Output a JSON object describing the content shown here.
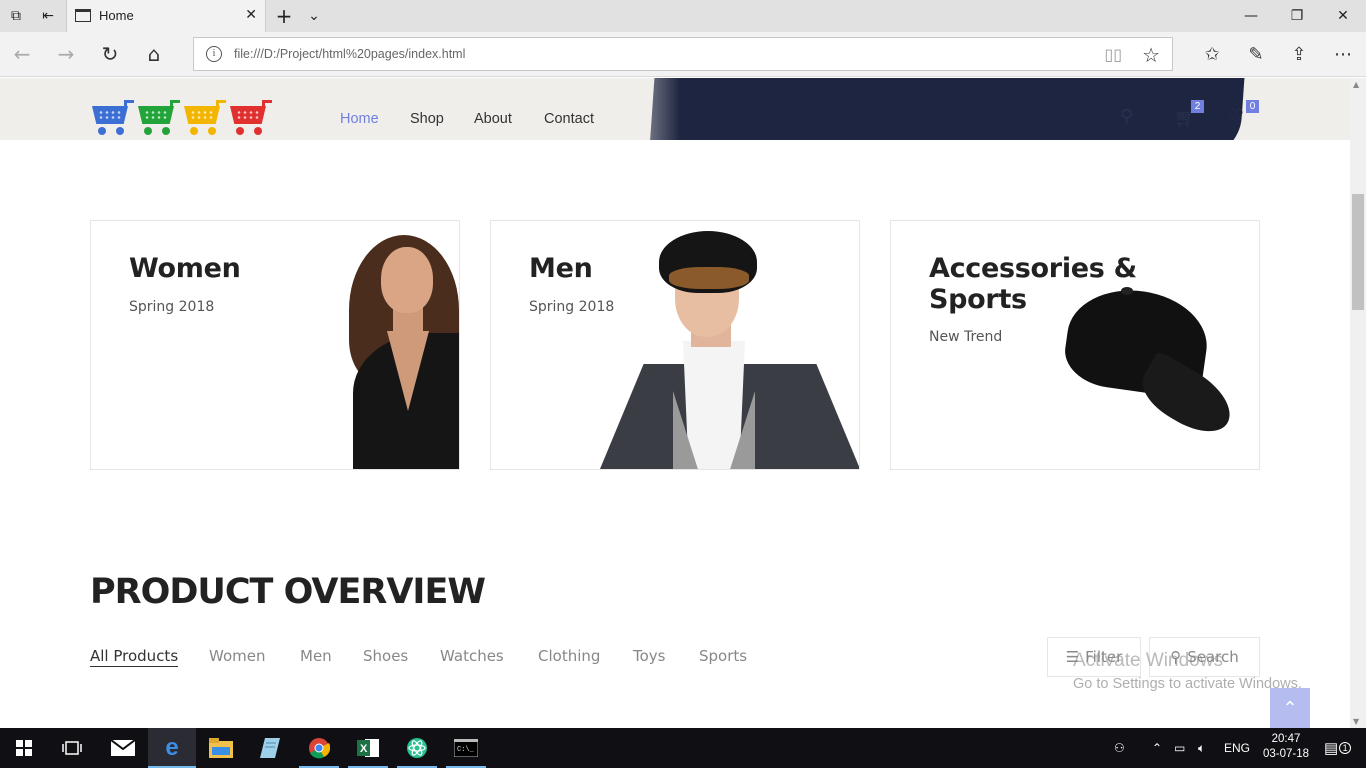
{
  "browser": {
    "tab_title": "Home",
    "url": "file:///D:/Project/html%20pages/index.html",
    "icons": [
      "tab-preview-icon",
      "set-aside-tabs-icon",
      "new-tab-icon",
      "tab-list-icon",
      "back-icon",
      "forward-icon",
      "refresh-icon",
      "home-icon",
      "reading-view-icon",
      "favorite-star-icon",
      "favorites-hub-icon",
      "notes-pen-icon",
      "share-icon",
      "more-icon"
    ]
  },
  "site": {
    "nav": [
      {
        "label": "Home",
        "active": true
      },
      {
        "label": "Shop",
        "active": false
      },
      {
        "label": "About",
        "active": false
      },
      {
        "label": "Contact",
        "active": false
      }
    ],
    "cart_count": "2",
    "wishlist_count": "0",
    "logo_colors": [
      "#3b6fd4",
      "#22a43a",
      "#f2b600",
      "#e03030"
    ]
  },
  "banners": [
    {
      "title": "Women",
      "subtitle": "Spring 2018"
    },
    {
      "title": "Men",
      "subtitle": "Spring 2018"
    },
    {
      "title": "Accessories & Sports",
      "title_line1": "Accessories &",
      "title_line2": "Sports",
      "subtitle": "New Trend"
    }
  ],
  "overview": {
    "title": "PRODUCT OVERVIEW",
    "filters": [
      "All Products",
      "Women",
      "Men",
      "Shoes",
      "Watches",
      "Clothing",
      "Toys",
      "Sports"
    ],
    "active_filter": "All Products",
    "filter_button": "Filter",
    "search_button": "Search"
  },
  "watermark": {
    "line1": "Activate Windows",
    "line2": "Go to Settings to activate Windows."
  },
  "taskbar": {
    "apps": [
      "start-icon",
      "task-view-icon",
      "mail-icon",
      "edge-icon",
      "file-explorer-icon",
      "notepad-icon",
      "chrome-icon",
      "excel-icon",
      "atom-icon",
      "cmd-icon"
    ],
    "language": "ENG",
    "time": "20:47",
    "date": "03-07-18",
    "notification_count": "1"
  },
  "colors": {
    "accent": "#717fe0",
    "jacket": "#1d2540",
    "taskbar": "#101014"
  }
}
